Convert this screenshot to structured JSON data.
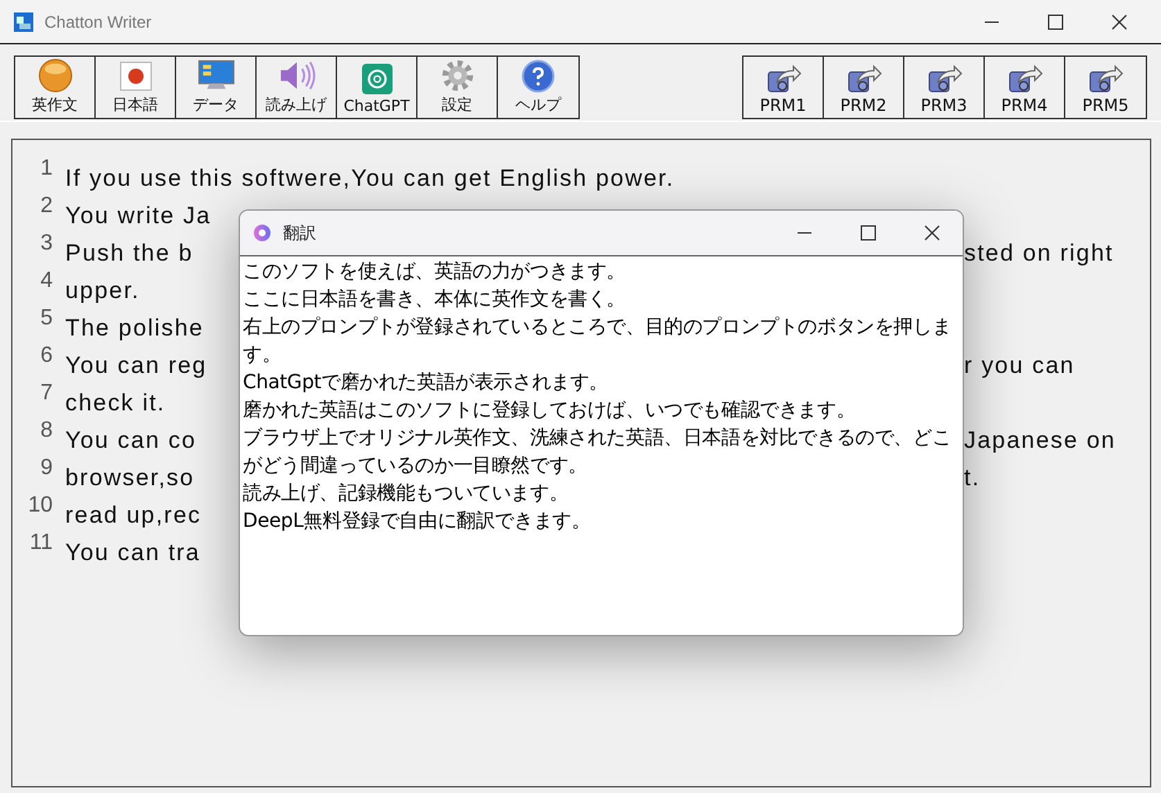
{
  "window": {
    "title": "Chatton Writer"
  },
  "toolbar": {
    "left": [
      {
        "label": "英作文",
        "kind": "en"
      },
      {
        "label": "日本語",
        "kind": "flag"
      },
      {
        "label": "データ",
        "kind": "monitor"
      },
      {
        "label": "読み上げ",
        "kind": "speaker"
      },
      {
        "label": "ChatGPT",
        "kind": "chatgpt"
      },
      {
        "label": "設定",
        "kind": "gear"
      },
      {
        "label": "ヘルプ",
        "kind": "help"
      }
    ],
    "right": [
      {
        "label": "PRM1",
        "kind": "prompt"
      },
      {
        "label": "PRM2",
        "kind": "prompt"
      },
      {
        "label": "PRM3",
        "kind": "prompt"
      },
      {
        "label": "PRM4",
        "kind": "prompt"
      },
      {
        "label": "PRM5",
        "kind": "prompt"
      }
    ]
  },
  "editor": {
    "lines": [
      {
        "number": "1",
        "text": "If you use this softwere,You can get English power."
      },
      {
        "number": "2",
        "text": "You write Ja"
      },
      {
        "number": "3",
        "text": "Push the  b",
        "right": "sted on right"
      },
      {
        "number": "4",
        "text": "upper."
      },
      {
        "number": "5",
        "text": "The polishe"
      },
      {
        "number": "6",
        "text": "You can reg",
        "right": "r you can"
      },
      {
        "number": "7",
        "text": "check it."
      },
      {
        "number": "8",
        "text": "You can  co",
        "right": "Japanese on"
      },
      {
        "number": "9",
        "text": "browser,so",
        "right": "t."
      },
      {
        "number": "10",
        "text": "read up,rec"
      },
      {
        "number": "11",
        "text": "You can tra"
      }
    ]
  },
  "dialog": {
    "title": "翻訳",
    "lines": [
      "このソフトを使えば、英語の力がつきます。",
      "ここに日本語を書き、本体に英作文を書く。",
      "右上のプロンプトが登録されているところで、目的のプロンプトのボタンを押します。",
      "ChatGptで磨かれた英語が表示されます。",
      "磨かれた英語はこのソフトに登録しておけば、いつでも確認できます。",
      "ブラウザ上でオリジナル英作文、洗練された英語、日本語を対比できるので、どこがどう間違っているのか一目瞭然です。",
      "読み上げ、記録機能もついています。",
      "DeepL無料登録で自由に翻訳できます。"
    ]
  }
}
